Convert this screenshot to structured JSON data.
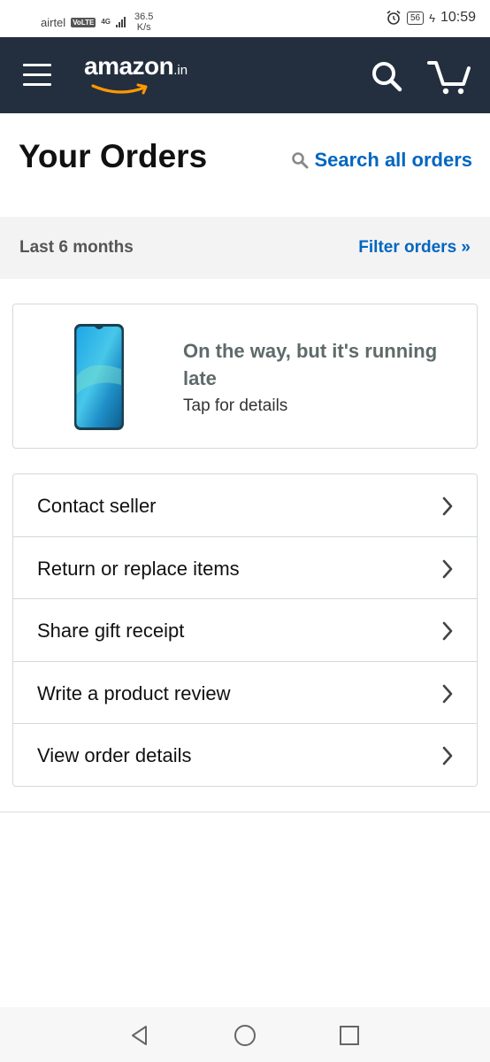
{
  "status_bar": {
    "carrier": "airtel",
    "volte": "VoLTE",
    "network_type": "4G",
    "speed_value": "36.5",
    "speed_unit": "K/s",
    "battery": "56",
    "time": "10:59"
  },
  "header": {
    "logo_main": "amazon",
    "logo_tld": ".in",
    "background_color": "#232f3e"
  },
  "page": {
    "title": "Your Orders",
    "search_label": "Search all orders"
  },
  "filter": {
    "range": "Last 6 months",
    "link": "Filter orders »"
  },
  "order": {
    "status": "On the way, but it's running late",
    "subtext": "Tap for details"
  },
  "actions": [
    {
      "label": "Contact seller"
    },
    {
      "label": "Return or replace items"
    },
    {
      "label": "Share gift receipt"
    },
    {
      "label": "Write a product review"
    },
    {
      "label": "View order details"
    }
  ],
  "colors": {
    "link": "#0066c0",
    "accent": "#ff9900"
  }
}
